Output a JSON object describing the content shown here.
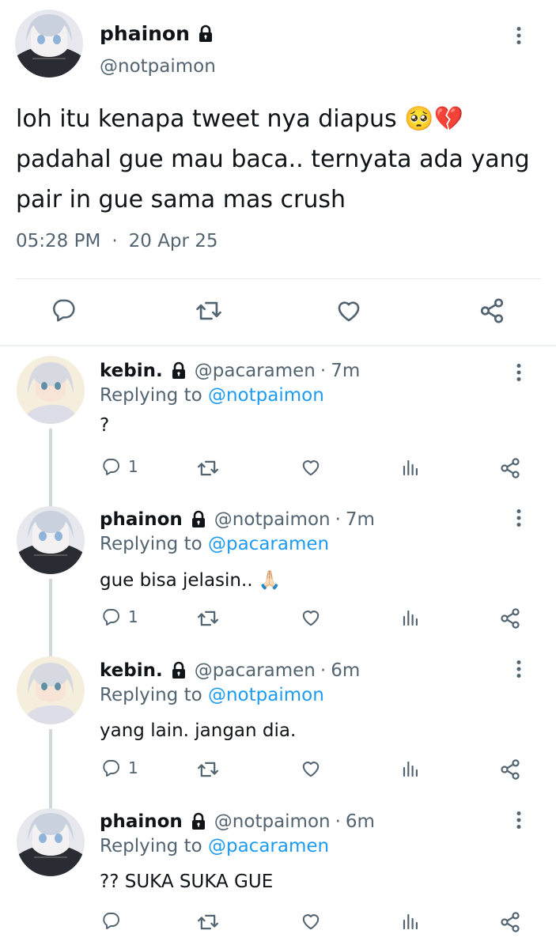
{
  "main_tweet": {
    "name": "phainon",
    "handle": "@notpaimon",
    "text_lines": [
      "loh itu kenapa tweet nya diapus",
      "padahal gue mau baca.. ternyata ada yang",
      "pair in gue sama mas crush"
    ],
    "emoji": "🥺💔",
    "time": "05:28 PM",
    "separator": "·",
    "date": "20 Apr 25"
  },
  "replies": [
    {
      "name": "kebin.",
      "handle": "@pacaramen",
      "dot": "·",
      "time": "7m",
      "replying_prefix": "Replying to",
      "replying_to": "@notpaimon",
      "text": "?",
      "reply_count": "1"
    },
    {
      "name": "phainon",
      "handle": "@notpaimon",
      "dot": "·",
      "time": "7m",
      "replying_prefix": "Replying to",
      "replying_to": "@pacaramen",
      "text": "gue bisa jelasin.. 🙏🏻",
      "reply_count": "1"
    },
    {
      "name": "kebin.",
      "handle": "@pacaramen",
      "dot": "·",
      "time": "6m",
      "replying_prefix": "Replying to",
      "replying_to": "@notpaimon",
      "text": "yang lain. jangan dia.",
      "reply_count": "1"
    },
    {
      "name": "phainon",
      "handle": "@notpaimon",
      "dot": "·",
      "time": "6m",
      "replying_prefix": "Replying to",
      "replying_to": "@pacaramen",
      "text": "?? SUKA SUKA GUE",
      "reply_count": ""
    }
  ],
  "icons": [
    "lock-icon",
    "more-icon",
    "reply-icon",
    "retweet-icon",
    "like-icon",
    "analytics-icon",
    "share-icon"
  ],
  "colors": {
    "text": "#0f1419",
    "muted": "#536471",
    "link": "#1d9bf0",
    "divider": "#e6e9ec"
  }
}
